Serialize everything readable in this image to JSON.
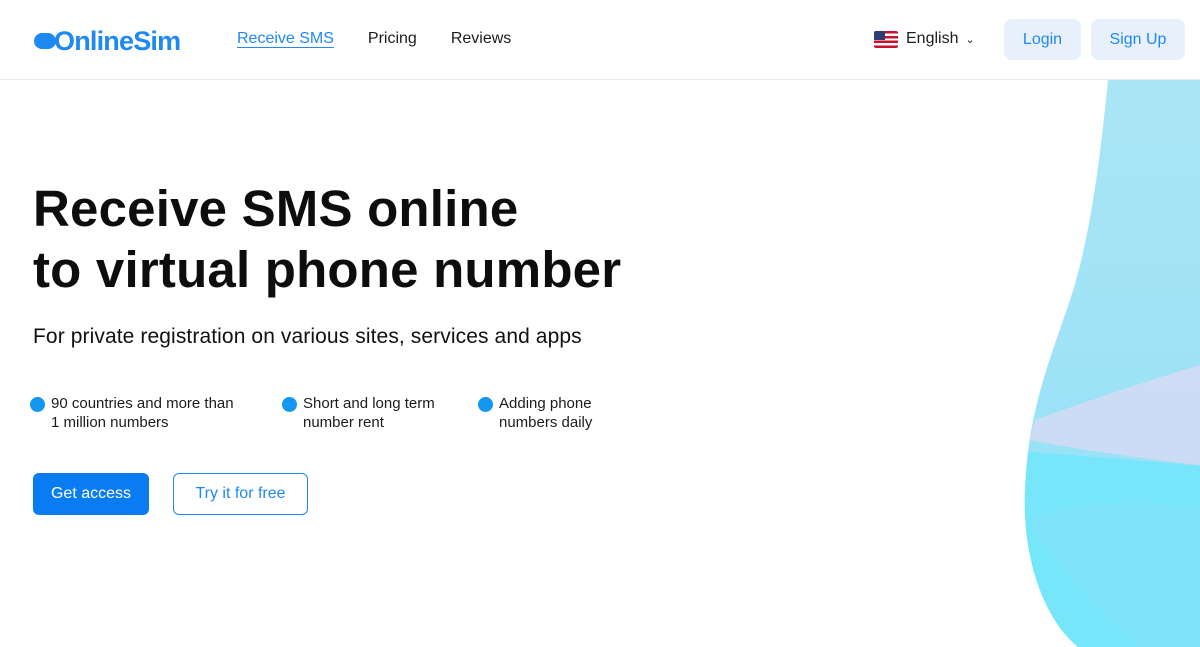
{
  "header": {
    "logo_text": "OnlineSim",
    "nav": [
      {
        "label": "Receive SMS",
        "active": true
      },
      {
        "label": "Pricing",
        "active": false
      },
      {
        "label": "Reviews",
        "active": false
      }
    ],
    "language": {
      "label": "English",
      "flag_icon": "us-flag-icon",
      "chevron_icon": "chevron-down-icon"
    },
    "login_label": "Login",
    "signup_label": "Sign Up"
  },
  "hero": {
    "title_line1": "Receive SMS online",
    "title_line2": "to virtual phone number",
    "subtitle": "For private registration on various sites, services and apps",
    "features": [
      {
        "line1": "90 countries and more than",
        "line2": "1 million numbers"
      },
      {
        "line1": "Short and long term",
        "line2": "number rent"
      },
      {
        "line1": "Adding phone",
        "line2": "numbers daily"
      }
    ],
    "primary_cta": "Get access",
    "secondary_cta": "Try it for free"
  },
  "colors": {
    "brand": "#1e88f5",
    "primary_button": "#0a7cf2",
    "soft_button_bg": "#e8f1fb",
    "feature_dot": "#1497f0"
  }
}
